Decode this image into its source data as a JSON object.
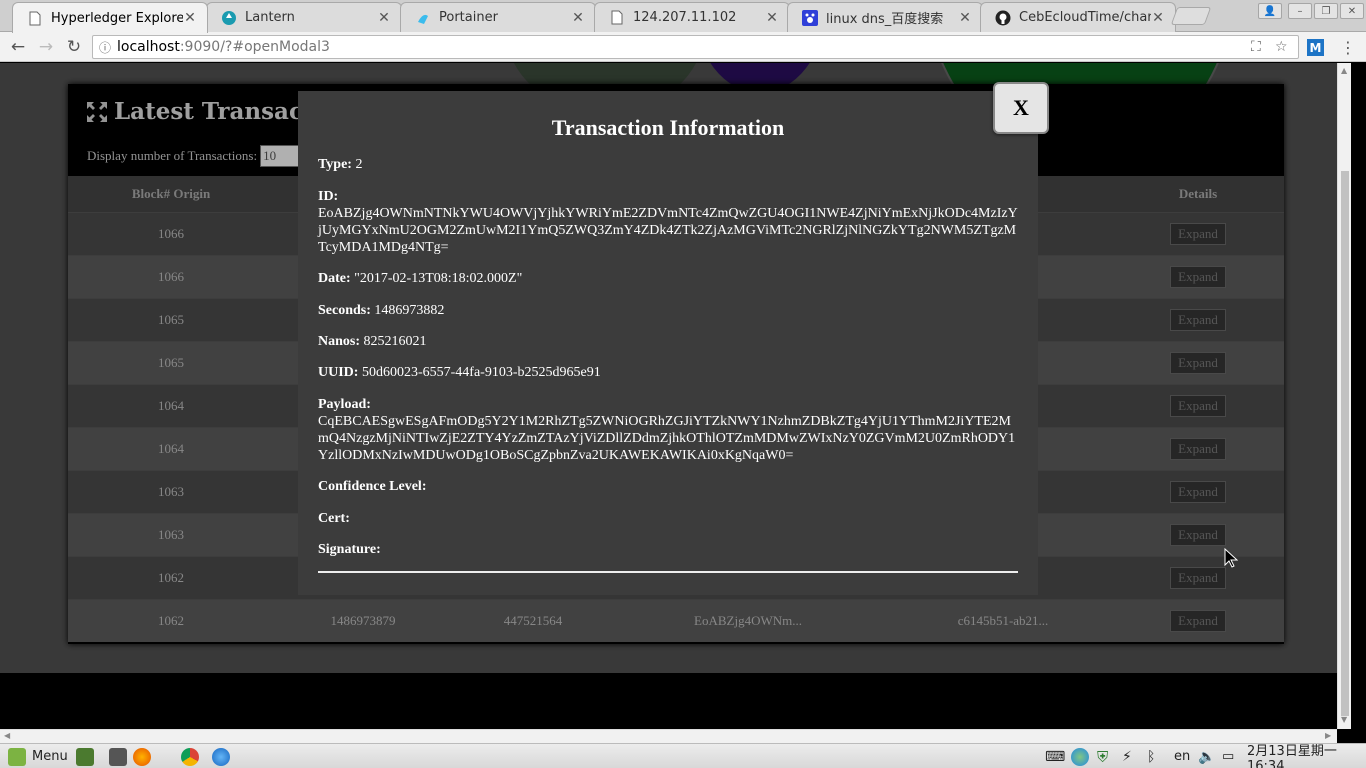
{
  "browser": {
    "tabs": [
      {
        "title": "Hyperledger Explorer",
        "icon": "page-icon",
        "active": true
      },
      {
        "title": "Lantern",
        "icon": "lantern-icon",
        "active": false
      },
      {
        "title": "Portainer",
        "icon": "portainer-icon",
        "active": false
      },
      {
        "title": "124.207.11.102",
        "icon": "page-icon",
        "active": false
      },
      {
        "title": "linux dns_百度搜索",
        "icon": "baidu-icon",
        "active": false
      },
      {
        "title": "CebEcloudTime/charity",
        "icon": "github-icon",
        "active": false
      }
    ],
    "url_host": "localhost",
    "url_rest": ":9090/?#openModal3",
    "extension_label": "M"
  },
  "page": {
    "panel_title": "Latest Transaction",
    "display_label": "Display number of Transactions:",
    "display_value": "10",
    "columns": {
      "block": "Block# Origin",
      "details": "Details"
    },
    "expand_label": "Expand",
    "rows": [
      {
        "block": "1066"
      },
      {
        "block": "1066"
      },
      {
        "block": "1065"
      },
      {
        "block": "1065"
      },
      {
        "block": "1064"
      },
      {
        "block": "1064"
      },
      {
        "block": "1063"
      },
      {
        "block": "1063"
      },
      {
        "block": "1062"
      },
      {
        "block": "1062",
        "seconds": "1486973879",
        "nanos": "447521564",
        "id": "EoABZjg4OWNm...",
        "uuid": "c6145b51-ab21..."
      }
    ]
  },
  "modal": {
    "title": "Transaction Information",
    "close_label": "X",
    "fields": {
      "type": {
        "label": "Type:",
        "value": "2"
      },
      "id": {
        "label": "ID:",
        "value": "EoABZjg4OWNmNTNkYWU4OWVjYjhkYWRiYmE2ZDVmNTc4ZmQwZGU4OGI1NWE4ZjNiYmExNjJkODc4MzIzYjUyMGYxNmU2OGM2ZmUwM2I1YmQ5ZWQ3ZmY4ZDk4ZTk2ZjAzMGViMTc2NGRlZjNlNGZkYTg2NWM5ZTgzMTcyMDA1MDg4NTg="
      },
      "date": {
        "label": "Date:",
        "value": "\"2017-02-13T08:18:02.000Z\""
      },
      "seconds": {
        "label": "Seconds:",
        "value": "1486973882"
      },
      "nanos": {
        "label": "Nanos:",
        "value": "825216021"
      },
      "uuid": {
        "label": "UUID:",
        "value": "50d60023-6557-44fa-9103-b2525d965e91"
      },
      "payload": {
        "label": "Payload:",
        "value": "CqEBCAESgwESgAFmODg5Y2Y1M2RhZTg5ZWNiOGRhZGJiYTZkNWY1NzhmZDBkZTg4YjU1YThmM2JiYTE2MmQ4NzgzMjNiNTIwZjE2ZTY4YzZmZTAzYjViZDllZDdmZjhkOThlOTZmMDMwZWIxNzY0ZGVmM2U0ZmRhODY1YzllODMxNzIwMDUwODg1OBoSCgZpbnZva2UKAWEKAWIKAi0xKgNqaW0="
      },
      "confidence": {
        "label": "Confidence Level:",
        "value": ""
      },
      "cert": {
        "label": "Cert:",
        "value": ""
      },
      "signature": {
        "label": "Signature:",
        "value": ""
      }
    }
  },
  "taskbar": {
    "menu_label": "Menu",
    "language": "en",
    "clock": "2月13日星期一 16:34"
  }
}
